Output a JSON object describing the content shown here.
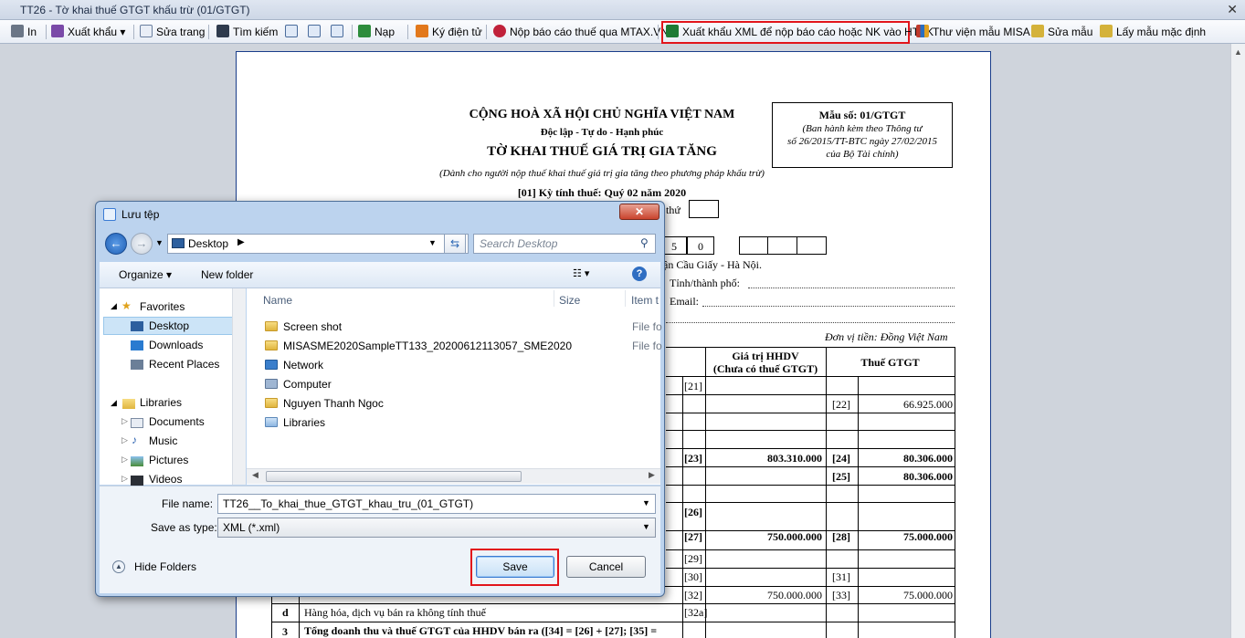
{
  "window": {
    "title": "TT26 - Tờ khai thuế GTGT khấu trừ (01/GTGT)"
  },
  "toolbar": {
    "print": "In",
    "export": "Xuất khẩu",
    "edit_page": "Sửa trang",
    "search": "Tìm kiếm",
    "load": "Nạp",
    "esign": "Ký điện tử",
    "submit_mtax": "Nộp báo cáo thuế qua MTAX.VN",
    "export_xml": "Xuất khẩu XML để nộp báo cáo hoặc NK vào HTKK",
    "misa_library": "Thư viện mẫu MISA",
    "edit_template": "Sửa mẫu",
    "default_template": "Lấy mẫu mặc định"
  },
  "document": {
    "country": "CỘNG HOÀ XÃ HỘI CHỦ NGHĨA VIỆT NAM",
    "motto": "Độc lập - Tự do - Hạnh phúc",
    "form_title": "TỜ KHAI THUẾ GIÁ TRỊ GIA TĂNG",
    "form_subtitle": "(Dành cho người nộp thuế khai thuế giá trị gia tăng theo phương pháp khấu trừ)",
    "period": "[01] Kỳ tính thuế: Quý 02 năm 2020",
    "form_code": "Mẫu số: 01/GTGT",
    "form_note": [
      "(Ban hành kèm theo Thông tư",
      "số 26/2015/TT-BTC ngày 27/02/2015",
      "của Bộ Tài chính)"
    ],
    "partial_lan_thu": "thứ",
    "partial_digits": [
      "5",
      "0"
    ],
    "partial_address": "ận Cầu Giấy - Hà Nội.",
    "partial_province": "Tỉnh/thành phố:",
    "partial_email": "Email:",
    "currency": "Đơn vị tiền: Đồng Việt Nam",
    "col_value": [
      "Giá trị HHDV",
      "(Chưa có thuế GTGT)"
    ],
    "col_tax": "Thuế GTGT",
    "rows": {
      "r21": "[21]",
      "r22_code": "[22]",
      "r22_val": "66.925.000",
      "r23_code": "[23]",
      "r23_val": "803.310.000",
      "r24_code": "[24]",
      "r24_val": "80.306.000",
      "r25_code": "[25]",
      "r25_val": "80.306.000",
      "r26": "[26]",
      "r27_code": "[27]",
      "r27_val": "750.000.000",
      "r28_code": "[28]",
      "r28_val": "75.000.000",
      "r29": "[29]",
      "r30": "[30]",
      "r31": "[31]",
      "r32_code": "[32]",
      "r32_val": "750.000.000",
      "r33_code": "[33]",
      "r33_val": "75.000.000",
      "d_label": "d",
      "d_text": "Hàng hóa, dịch vụ bán ra không tính thuế",
      "r32a": "[32a]",
      "s3_label": "3",
      "s3_text": "Tổng doanh thu và thuế GTGT của HHDV bán ra ([34] = [26] + [27]; [35] ="
    }
  },
  "dialog": {
    "title": "Lưu tệp",
    "address": "Desktop",
    "search_placeholder": "Search Desktop",
    "organize": "Organize",
    "new_folder": "New folder",
    "nav": {
      "favorites": "Favorites",
      "desktop": "Desktop",
      "downloads": "Downloads",
      "recent": "Recent Places",
      "libraries": "Libraries",
      "documents": "Documents",
      "music": "Music",
      "pictures": "Pictures",
      "videos": "Videos"
    },
    "columns": {
      "name": "Name",
      "size": "Size",
      "type": "Item t"
    },
    "files": [
      {
        "name": "Screen shot",
        "type": "File fo"
      },
      {
        "name": "MISASME2020SampleTT133_20200612113057_SME2020",
        "type": "File fo"
      },
      {
        "name": "Network",
        "type": ""
      },
      {
        "name": "Computer",
        "type": ""
      },
      {
        "name": "Nguyen Thanh Ngoc",
        "type": ""
      },
      {
        "name": "Libraries",
        "type": ""
      }
    ],
    "file_name_label": "File name:",
    "file_name_value": "TT26__To_khai_thue_GTGT_khau_tru_(01_GTGT)",
    "save_type_label": "Save as type:",
    "save_type_value": "XML (*.xml)",
    "hide_folders": "Hide Folders",
    "save": "Save",
    "cancel": "Cancel"
  },
  "colors": {
    "highlight": "#e2151b",
    "dialog_frame": "#bcd3ee"
  }
}
